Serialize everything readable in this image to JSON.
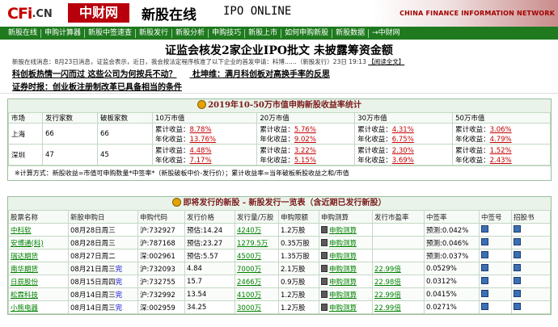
{
  "header": {
    "logo_cfi": "CFi",
    "logo_cn": ".CN",
    "logo_red": "中财网",
    "title": "新股在线",
    "subtitle": "IPO ONLINE",
    "brand": "CHINA FINANCE INFORMATION NETWORK"
  },
  "nav": [
    "新股在线",
    "申购计算器",
    "新股中签速查",
    "新股发行",
    "新股分析",
    "申购技巧",
    "新股上市",
    "如何申购新股",
    "新股数据",
    "→中财网"
  ],
  "headline": "证监会核发2家企业IPO批文  未披露筹资金额",
  "news": {
    "text": "新股在线消息：8月23日消息，证监会表示，近日，我会按法定程序核准了以下企业的首发申请：科博……（新股发行）23日  19:13",
    "link": "【阅读全文】"
  },
  "links": {
    "row1": [
      "科创板热情一闪而过 这些公司为何按兵不动？",
      "杜坤维：满月科创板对高换手率的反思"
    ],
    "row2": [
      "证券时报：创业板注册制改革已具备相当的条件"
    ]
  },
  "stats": {
    "title": "2019年10-50万市值申购新股收益率统计",
    "headers": [
      "市场",
      "发行家数",
      "破板家数",
      "10万市值",
      "20万市值",
      "30万市值",
      "50万市值"
    ],
    "rows": [
      {
        "market": "上海",
        "issued": "66",
        "broken": "66",
        "cells": [
          [
            "累计收益：",
            "8.78%",
            "年化收益：",
            "13.76%"
          ],
          [
            "累计收益：",
            "5.76%",
            "年化收益：",
            "9.02%"
          ],
          [
            "累计收益：",
            "4.31%",
            "年化收益：",
            "6.75%"
          ],
          [
            "累计收益：",
            "3.06%",
            "年化收益：",
            "4.79%"
          ]
        ]
      },
      {
        "market": "深圳",
        "issued": "47",
        "broken": "45",
        "cells": [
          [
            "累计收益：",
            "4.48%",
            "年化收益：",
            "7.17%"
          ],
          [
            "累计收益：",
            "3.22%",
            "年化收益：",
            "5.15%"
          ],
          [
            "累计收益：",
            "2.30%",
            "年化收益：",
            "3.69%"
          ],
          [
            "累计收益：",
            "1.52%",
            "年化收益：",
            "2.43%"
          ]
        ]
      }
    ],
    "note": "※计算方式：新股收益=市值可申购数量*中签率*（新股破板中价-发行价）；累计收益率=当年破板新股收益之和/市值"
  },
  "ipo": {
    "title": "即将发行的新股 - 新股发行一览表（含近期已发行新股）",
    "headers": [
      "股票名称",
      "新股申购日",
      "申购代码",
      "发行价格",
      "发行量/万股",
      "申购限额",
      "申购测算",
      "发行市盈率",
      "中签率",
      "中签号",
      "招股书"
    ],
    "rows": [
      {
        "name": "中科软",
        "date": "08月28日周三",
        "completed": "",
        "code": "沪:732927",
        "price": "预估:14.24",
        "volume": "4240万",
        "limit": "1.2万股",
        "calc": "申购测算",
        "pe": "",
        "rate": "预测:0.042%"
      },
      {
        "name": "安博通(科)",
        "date": "08月28日周三",
        "completed": "",
        "code": "沪:787168",
        "price": "预估:23.27",
        "volume": "1279.5万",
        "limit": "0.35万股",
        "calc": "申购测算",
        "pe": "",
        "rate": "预测:0.046%"
      },
      {
        "name": "瑞达期货",
        "date": "08月27日周二",
        "completed": "",
        "code": "深:002961",
        "price": "预估:5.57",
        "volume": "4500万",
        "limit": "1.35万股",
        "calc": "申购测算",
        "pe": "",
        "rate": "预测:0.037%"
      },
      {
        "name": "南华期货",
        "date": "08月21日周三",
        "completed": "完",
        "code": "沪:732093",
        "price": "4.84",
        "volume": "7000万",
        "limit": "2.1万股",
        "calc": "申购测算",
        "pe": "22.99倍",
        "rate": "0.0529%"
      },
      {
        "name": "日辰股份",
        "date": "08月15日周四",
        "completed": "完",
        "code": "沪:732755",
        "price": "15.7",
        "volume": "2466万",
        "limit": "0.9万股",
        "calc": "申购测算",
        "pe": "22.98倍",
        "rate": "0.0312%"
      },
      {
        "name": "松霖科技",
        "date": "08月14日周三",
        "completed": "完",
        "code": "沪:732992",
        "price": "13.54",
        "volume": "4100万",
        "limit": "1.2万股",
        "calc": "申购测算",
        "pe": "22.99倍",
        "rate": "0.0415%"
      },
      {
        "name": "小熊电器",
        "date": "08月14日周三",
        "completed": "完",
        "code": "深:002959",
        "price": "34.25",
        "volume": "3000万",
        "limit": "1.2万股",
        "calc": "申购测算",
        "pe": "22.99倍",
        "rate": "0.0271%"
      }
    ]
  }
}
